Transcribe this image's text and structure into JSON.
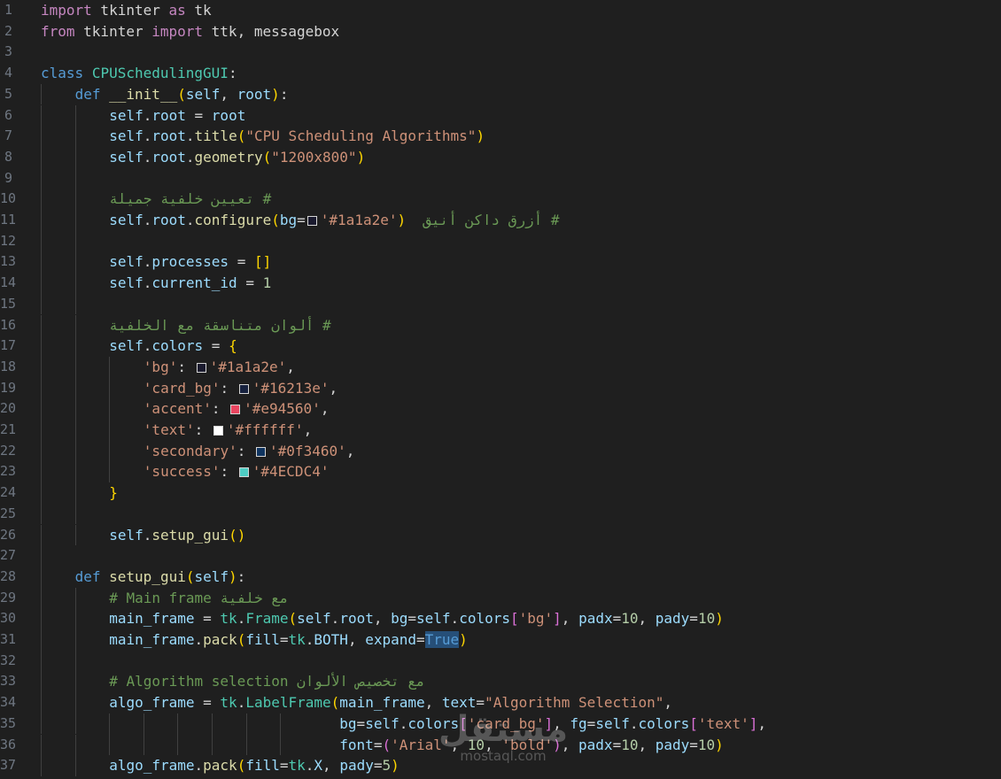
{
  "editor": {
    "language": "python",
    "colors": {
      "background": "#1f1f1f",
      "keyword": "#569cd6",
      "control": "#c586c0",
      "string": "#ce9178",
      "number": "#b5cea8",
      "comment": "#6a9955",
      "function": "#dcdcaa",
      "class": "#4ec9b0",
      "variable": "#9cdcfe"
    },
    "lines": [
      {
        "n": "1",
        "indent": 0,
        "tokens": [
          [
            "ctl",
            "import"
          ],
          [
            "sp",
            " tkinter "
          ],
          [
            "ctl",
            "as"
          ],
          [
            "sp",
            " tk"
          ]
        ]
      },
      {
        "n": "2",
        "indent": 0,
        "tokens": [
          [
            "ctl",
            "from"
          ],
          [
            "sp",
            " tkinter "
          ],
          [
            "ctl",
            "import"
          ],
          [
            "sp",
            " ttk, messagebox"
          ]
        ]
      },
      {
        "n": "3",
        "indent": 0,
        "tokens": []
      },
      {
        "n": "4",
        "indent": 0,
        "tokens": [
          [
            "kw",
            "class"
          ],
          [
            "sp",
            " "
          ],
          [
            "cls",
            "CPUSchedulingGUI"
          ],
          [
            "sp",
            ":"
          ]
        ]
      },
      {
        "n": "5",
        "indent": 1,
        "tokens": [
          [
            "kw",
            "def"
          ],
          [
            "sp",
            " "
          ],
          [
            "fn",
            "__init__"
          ],
          [
            "br1",
            "("
          ],
          [
            "var",
            "self"
          ],
          [
            "sp",
            ", "
          ],
          [
            "var",
            "root"
          ],
          [
            "br1",
            ")"
          ],
          [
            "sp",
            ":"
          ]
        ]
      },
      {
        "n": "6",
        "indent": 2,
        "tokens": [
          [
            "var",
            "self"
          ],
          [
            "sp",
            "."
          ],
          [
            "var",
            "root"
          ],
          [
            "sp",
            " = "
          ],
          [
            "var",
            "root"
          ]
        ]
      },
      {
        "n": "7",
        "indent": 2,
        "tokens": [
          [
            "var",
            "self"
          ],
          [
            "sp",
            "."
          ],
          [
            "var",
            "root"
          ],
          [
            "sp",
            "."
          ],
          [
            "fn",
            "title"
          ],
          [
            "br1",
            "("
          ],
          [
            "str",
            "\"CPU Scheduling Algorithms\""
          ],
          [
            "br1",
            ")"
          ]
        ]
      },
      {
        "n": "8",
        "indent": 2,
        "tokens": [
          [
            "var",
            "self"
          ],
          [
            "sp",
            "."
          ],
          [
            "var",
            "root"
          ],
          [
            "sp",
            "."
          ],
          [
            "fn",
            "geometry"
          ],
          [
            "br1",
            "("
          ],
          [
            "str",
            "\"1200x800\""
          ],
          [
            "br1",
            ")"
          ]
        ]
      },
      {
        "n": "9",
        "indent": 2,
        "tokens": []
      },
      {
        "n": "10",
        "indent": 2,
        "tokens": [
          [
            "cmt",
            "# تعيين خلفية جميلة"
          ]
        ]
      },
      {
        "n": "11",
        "indent": 2,
        "tokens": [
          [
            "var",
            "self"
          ],
          [
            "sp",
            "."
          ],
          [
            "var",
            "root"
          ],
          [
            "sp",
            "."
          ],
          [
            "fn",
            "configure"
          ],
          [
            "br1",
            "("
          ],
          [
            "var",
            "bg"
          ],
          [
            "sp",
            "="
          ],
          [
            "swatch",
            "#1a1a2e"
          ],
          [
            "str",
            "'#1a1a2e'"
          ],
          [
            "br1",
            ")"
          ],
          [
            "sp",
            "  "
          ],
          [
            "cmt",
            "# أزرق داكن أنيق"
          ]
        ]
      },
      {
        "n": "12",
        "indent": 2,
        "tokens": []
      },
      {
        "n": "13",
        "indent": 2,
        "tokens": [
          [
            "var",
            "self"
          ],
          [
            "sp",
            "."
          ],
          [
            "var",
            "processes"
          ],
          [
            "sp",
            " = "
          ],
          [
            "br1",
            "[]"
          ]
        ]
      },
      {
        "n": "14",
        "indent": 2,
        "tokens": [
          [
            "var",
            "self"
          ],
          [
            "sp",
            "."
          ],
          [
            "var",
            "current_id"
          ],
          [
            "sp",
            " = "
          ],
          [
            "num",
            "1"
          ]
        ]
      },
      {
        "n": "15",
        "indent": 2,
        "tokens": []
      },
      {
        "n": "16",
        "indent": 2,
        "tokens": [
          [
            "cmt",
            "# ألوان متناسقة مع الخلفية"
          ]
        ]
      },
      {
        "n": "17",
        "indent": 2,
        "tokens": [
          [
            "var",
            "self"
          ],
          [
            "sp",
            "."
          ],
          [
            "var",
            "colors"
          ],
          [
            "sp",
            " = "
          ],
          [
            "br1",
            "{"
          ]
        ]
      },
      {
        "n": "18",
        "indent": 3,
        "tokens": [
          [
            "str",
            "'bg'"
          ],
          [
            "sp",
            ": "
          ],
          [
            "swatch",
            "#1a1a2e"
          ],
          [
            "str",
            "'#1a1a2e'"
          ],
          [
            "sp",
            ","
          ]
        ]
      },
      {
        "n": "19",
        "indent": 3,
        "tokens": [
          [
            "str",
            "'card_bg'"
          ],
          [
            "sp",
            ": "
          ],
          [
            "swatch",
            "#16213e"
          ],
          [
            "str",
            "'#16213e'"
          ],
          [
            "sp",
            ","
          ]
        ]
      },
      {
        "n": "20",
        "indent": 3,
        "tokens": [
          [
            "str",
            "'accent'"
          ],
          [
            "sp",
            ": "
          ],
          [
            "swatch",
            "#e94560"
          ],
          [
            "str",
            "'#e94560'"
          ],
          [
            "sp",
            ","
          ]
        ]
      },
      {
        "n": "21",
        "indent": 3,
        "tokens": [
          [
            "str",
            "'text'"
          ],
          [
            "sp",
            ": "
          ],
          [
            "swatch",
            "#ffffff"
          ],
          [
            "str",
            "'#ffffff'"
          ],
          [
            "sp",
            ","
          ]
        ]
      },
      {
        "n": "22",
        "indent": 3,
        "tokens": [
          [
            "str",
            "'secondary'"
          ],
          [
            "sp",
            ": "
          ],
          [
            "swatch",
            "#0f3460"
          ],
          [
            "str",
            "'#0f3460'"
          ],
          [
            "sp",
            ","
          ]
        ]
      },
      {
        "n": "23",
        "indent": 3,
        "tokens": [
          [
            "str",
            "'success'"
          ],
          [
            "sp",
            ": "
          ],
          [
            "swatch",
            "#4ECDC4"
          ],
          [
            "str",
            "'#4ECDC4'"
          ]
        ]
      },
      {
        "n": "24",
        "indent": 2,
        "tokens": [
          [
            "br1",
            "}"
          ]
        ]
      },
      {
        "n": "25",
        "indent": 2,
        "tokens": []
      },
      {
        "n": "26",
        "indent": 2,
        "tokens": [
          [
            "var",
            "self"
          ],
          [
            "sp",
            "."
          ],
          [
            "fn",
            "setup_gui"
          ],
          [
            "br1",
            "()"
          ]
        ]
      },
      {
        "n": "27",
        "indent": 1,
        "tokens": []
      },
      {
        "n": "28",
        "indent": 1,
        "tokens": [
          [
            "kw",
            "def"
          ],
          [
            "sp",
            " "
          ],
          [
            "fn",
            "setup_gui"
          ],
          [
            "br1",
            "("
          ],
          [
            "var",
            "self"
          ],
          [
            "br1",
            ")"
          ],
          [
            "sp",
            ":"
          ]
        ]
      },
      {
        "n": "29",
        "indent": 2,
        "tokens": [
          [
            "cmt",
            "# Main frame مع خلفية"
          ]
        ]
      },
      {
        "n": "30",
        "indent": 2,
        "tokens": [
          [
            "var",
            "main_frame"
          ],
          [
            "sp",
            " = "
          ],
          [
            "cls",
            "tk"
          ],
          [
            "sp",
            "."
          ],
          [
            "cls",
            "Frame"
          ],
          [
            "br1",
            "("
          ],
          [
            "var",
            "self"
          ],
          [
            "sp",
            "."
          ],
          [
            "var",
            "root"
          ],
          [
            "sp",
            ", "
          ],
          [
            "var",
            "bg"
          ],
          [
            "sp",
            "="
          ],
          [
            "var",
            "self"
          ],
          [
            "sp",
            "."
          ],
          [
            "var",
            "colors"
          ],
          [
            "br2",
            "["
          ],
          [
            "str",
            "'bg'"
          ],
          [
            "br2",
            "]"
          ],
          [
            "sp",
            ", "
          ],
          [
            "var",
            "padx"
          ],
          [
            "sp",
            "="
          ],
          [
            "num",
            "10"
          ],
          [
            "sp",
            ", "
          ],
          [
            "var",
            "pady"
          ],
          [
            "sp",
            "="
          ],
          [
            "num",
            "10"
          ],
          [
            "br1",
            ")"
          ]
        ]
      },
      {
        "n": "31",
        "indent": 2,
        "tokens": [
          [
            "var",
            "main_frame"
          ],
          [
            "sp",
            "."
          ],
          [
            "fn",
            "pack"
          ],
          [
            "br1",
            "("
          ],
          [
            "var",
            "fill"
          ],
          [
            "sp",
            "="
          ],
          [
            "cls",
            "tk"
          ],
          [
            "sp",
            "."
          ],
          [
            "var",
            "BOTH"
          ],
          [
            "sp",
            ", "
          ],
          [
            "var",
            "expand"
          ],
          [
            "sp",
            "="
          ],
          [
            "hl",
            "True"
          ],
          [
            "br1",
            ")"
          ]
        ]
      },
      {
        "n": "32",
        "indent": 2,
        "tokens": []
      },
      {
        "n": "33",
        "indent": 2,
        "tokens": [
          [
            "cmt",
            "# Algorithm selection مع تخصيص الألوان"
          ]
        ]
      },
      {
        "n": "34",
        "indent": 2,
        "tokens": [
          [
            "var",
            "algo_frame"
          ],
          [
            "sp",
            " = "
          ],
          [
            "cls",
            "tk"
          ],
          [
            "sp",
            "."
          ],
          [
            "cls",
            "LabelFrame"
          ],
          [
            "br1",
            "("
          ],
          [
            "var",
            "main_frame"
          ],
          [
            "sp",
            ", "
          ],
          [
            "var",
            "text"
          ],
          [
            "sp",
            "="
          ],
          [
            "str",
            "\"Algorithm Selection\""
          ],
          [
            "sp",
            ","
          ]
        ]
      },
      {
        "n": "35",
        "indent": 2,
        "pad": "                           ",
        "tokens": [
          [
            "var",
            "bg"
          ],
          [
            "sp",
            "="
          ],
          [
            "var",
            "self"
          ],
          [
            "sp",
            "."
          ],
          [
            "var",
            "colors"
          ],
          [
            "br2",
            "["
          ],
          [
            "str",
            "'card_bg'"
          ],
          [
            "br2",
            "]"
          ],
          [
            "sp",
            ", "
          ],
          [
            "var",
            "fg"
          ],
          [
            "sp",
            "="
          ],
          [
            "var",
            "self"
          ],
          [
            "sp",
            "."
          ],
          [
            "var",
            "colors"
          ],
          [
            "br2",
            "["
          ],
          [
            "str",
            "'text'"
          ],
          [
            "br2",
            "]"
          ],
          [
            "sp",
            ","
          ]
        ]
      },
      {
        "n": "36",
        "indent": 2,
        "pad": "                           ",
        "tokens": [
          [
            "var",
            "font"
          ],
          [
            "sp",
            "="
          ],
          [
            "br2",
            "("
          ],
          [
            "str",
            "'Arial'"
          ],
          [
            "sp",
            ", "
          ],
          [
            "num",
            "10"
          ],
          [
            "sp",
            ", "
          ],
          [
            "str",
            "'bold'"
          ],
          [
            "br2",
            ")"
          ],
          [
            "sp",
            ", "
          ],
          [
            "var",
            "padx"
          ],
          [
            "sp",
            "="
          ],
          [
            "num",
            "10"
          ],
          [
            "sp",
            ", "
          ],
          [
            "var",
            "pady"
          ],
          [
            "sp",
            "="
          ],
          [
            "num",
            "10"
          ],
          [
            "br1",
            ")"
          ]
        ]
      },
      {
        "n": "37",
        "indent": 2,
        "tokens": [
          [
            "var",
            "algo_frame"
          ],
          [
            "sp",
            "."
          ],
          [
            "fn",
            "pack"
          ],
          [
            "br1",
            "("
          ],
          [
            "var",
            "fill"
          ],
          [
            "sp",
            "="
          ],
          [
            "cls",
            "tk"
          ],
          [
            "sp",
            "."
          ],
          [
            "var",
            "X"
          ],
          [
            "sp",
            ", "
          ],
          [
            "var",
            "pady"
          ],
          [
            "sp",
            "="
          ],
          [
            "num",
            "5"
          ],
          [
            "br1",
            ")"
          ]
        ]
      }
    ]
  },
  "watermark": {
    "arabic": "مستقل",
    "latin": "mostaql.com"
  }
}
